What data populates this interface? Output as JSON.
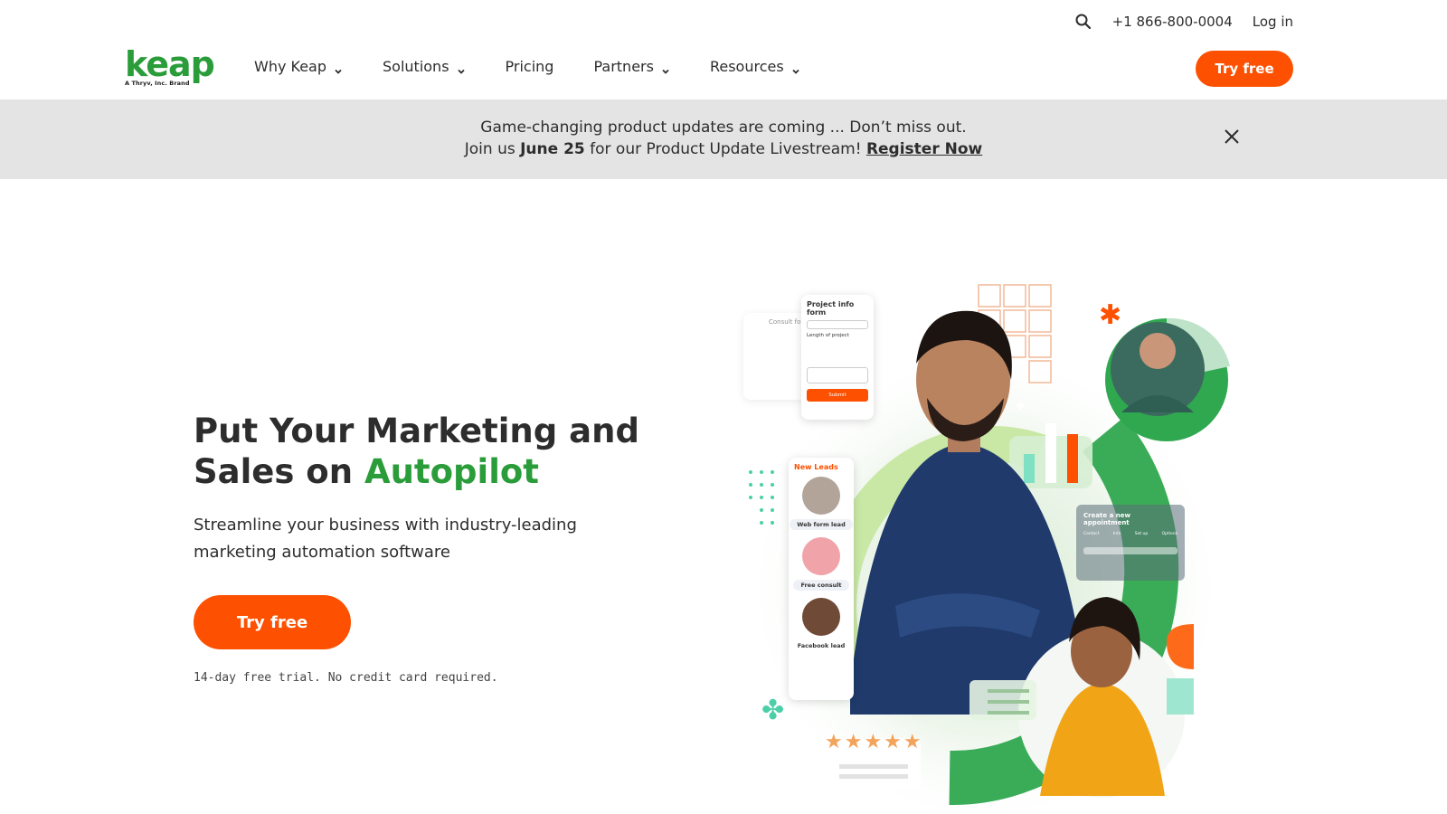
{
  "utility": {
    "phone": "+1 866-800-0004",
    "login": "Log in"
  },
  "brand": {
    "name": "keap",
    "tagline": "A Thryv, Inc. Brand",
    "color": "#2a9d3a"
  },
  "nav": {
    "items": [
      {
        "label": "Why Keap",
        "dropdown": true
      },
      {
        "label": "Solutions",
        "dropdown": true
      },
      {
        "label": "Pricing",
        "dropdown": false
      },
      {
        "label": "Partners",
        "dropdown": true
      },
      {
        "label": "Resources",
        "dropdown": true
      }
    ],
    "cta": "Try free"
  },
  "banner": {
    "line1": "Game-changing product updates are coming ... Don’t miss out.",
    "line2_prefix": "Join us ",
    "line2_date": "June 25",
    "line2_suffix": " for our Product Update Livestream! ",
    "link": "Register Now"
  },
  "hero": {
    "title_part1": "Put Your Marketing and Sales on ",
    "title_accent": "Autopilot",
    "subtitle": "Streamline your business with industry-leading marketing automation software",
    "cta": "Try free",
    "note": "14-day free trial. No credit card required."
  },
  "illustration": {
    "form_title": "Project info form",
    "form_label_length": "Length of project",
    "form_submit": "Submit",
    "form_behind_title": "Consult fo",
    "leads_title": "New Leads",
    "lead_tags": [
      "Web form lead",
      "Free consult",
      "Facebook lead"
    ],
    "appointment_title": "Create a new appointment",
    "appointment_steps": [
      "Contact",
      "Info",
      "Set up",
      "Options"
    ],
    "rating": "★★★★★"
  },
  "colors": {
    "accent_orange": "#fd5000",
    "brand_green": "#2a9d3a",
    "banner_bg": "#e4e4e4"
  }
}
